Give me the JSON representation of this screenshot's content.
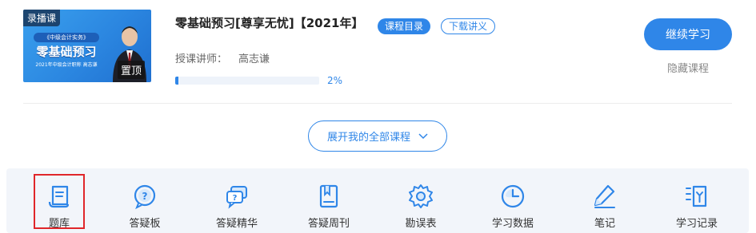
{
  "course": {
    "thumbnail": {
      "type_badge": "录播课",
      "subtitle_top": "《中级会计实务》",
      "main_text": "零基础预习",
      "subtitle_bottom": "2021年中级会计职称 高志谦",
      "pin_label": "置顶"
    },
    "title": "零基础预习[尊享无忧]【2021年】",
    "catalog_button": "课程目录",
    "download_button": "下载讲义",
    "instructor_label": "授课讲师：",
    "instructor_name": "高志谦",
    "progress": 0.02,
    "progress_text": "2%",
    "continue_button": "继续学习",
    "hide_link": "隐藏课程"
  },
  "expand_button": {
    "label": "展开我的全部课程",
    "icon": "chevron-down-icon"
  },
  "tools": [
    {
      "label": "题库",
      "icon": "question-bank-icon",
      "selected": true
    },
    {
      "label": "答疑板",
      "icon": "question-bubble-icon",
      "selected": false
    },
    {
      "label": "答疑精华",
      "icon": "qa-highlights-icon",
      "selected": false
    },
    {
      "label": "答疑周刊",
      "icon": "weekly-book-icon",
      "selected": false
    },
    {
      "label": "勘误表",
      "icon": "gear-icon",
      "selected": false
    },
    {
      "label": "学习数据",
      "icon": "clock-icon",
      "selected": false
    },
    {
      "label": "笔记",
      "icon": "pencil-note-icon",
      "selected": false
    },
    {
      "label": "学习记录",
      "icon": "record-list-icon",
      "selected": false
    }
  ],
  "colors": {
    "accent": "#2f86e8",
    "selected_outline": "#e0262a",
    "toolbar_bg": "#f2f5fa"
  }
}
